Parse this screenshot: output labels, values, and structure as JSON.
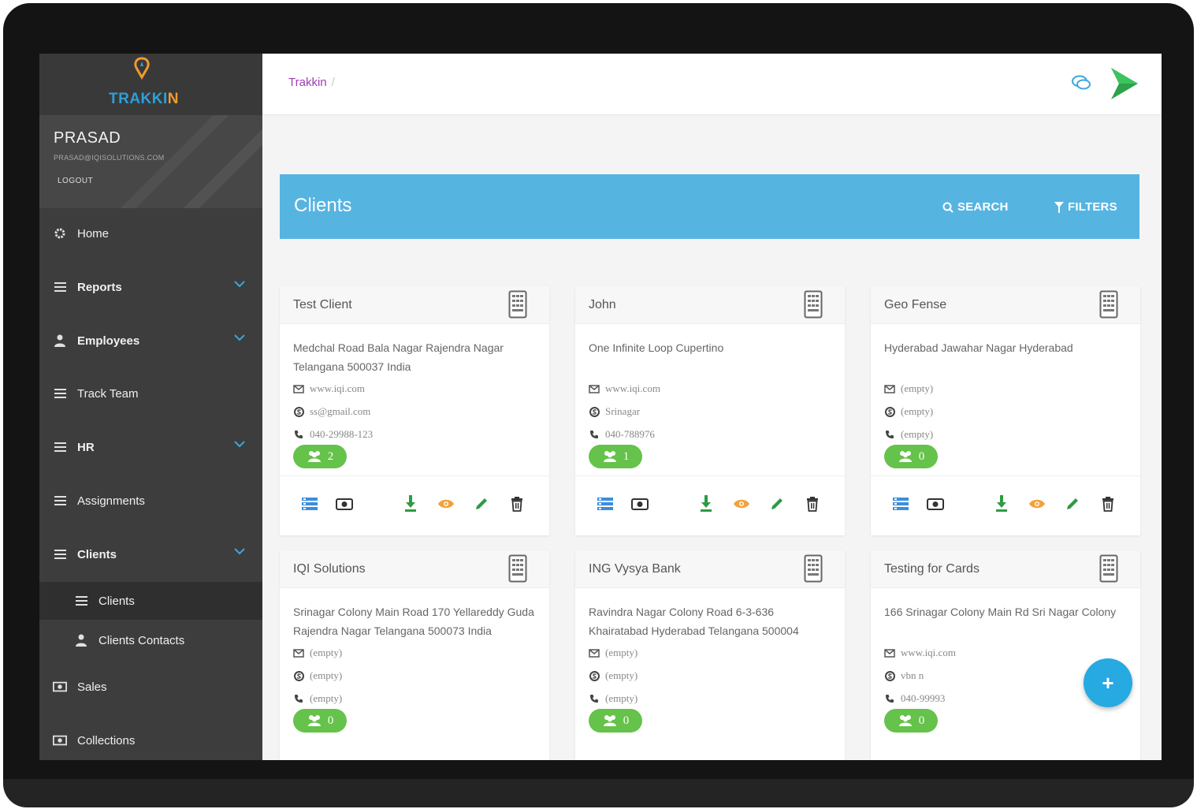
{
  "app": {
    "logo_text_1": "TRAKKI",
    "logo_text_2": "N"
  },
  "user": {
    "name": "PRASAD",
    "email": "PRASAD@IQISOLUTIONS.COM",
    "logout_label": "LOGOUT"
  },
  "sidebar": {
    "items": [
      {
        "label": "Home",
        "icon": "gear-icon"
      },
      {
        "label": "Reports",
        "icon": "list-icon"
      },
      {
        "label": "Employees",
        "icon": "user-icon"
      },
      {
        "label": "Track Team",
        "icon": "list-icon"
      },
      {
        "label": "HR",
        "icon": "list-icon"
      },
      {
        "label": "Assignments",
        "icon": "list-icon"
      },
      {
        "label": "Clients",
        "icon": "list-icon"
      },
      {
        "label": "Clients",
        "icon": "list-icon"
      },
      {
        "label": "Clients Contacts",
        "icon": "user-icon"
      },
      {
        "label": "Sales",
        "icon": "money-icon"
      },
      {
        "label": "Collections",
        "icon": "money-icon"
      }
    ]
  },
  "breadcrumb": {
    "root": "Trakkin",
    "separator": "/"
  },
  "header": {
    "title": "Clients",
    "search_label": "SEARCH",
    "filters_label": "FILTERS"
  },
  "cards": [
    {
      "name": "Test Client",
      "address": "Medchal Road Bala Nagar Rajendra Nagar Telangana 500037 India",
      "website": "www.iqi.com",
      "skype": "ss@gmail.com",
      "phone": "040-29988-123",
      "count": "2"
    },
    {
      "name": "John",
      "address": "One Infinite Loop Cupertino",
      "website": "www.iqi.com",
      "skype": "Srinagar",
      "phone": "040-788976",
      "count": "1"
    },
    {
      "name": "Geo Fense",
      "address": "Hyderabad Jawahar Nagar Hyderabad",
      "website": "(empty)",
      "skype": "(empty)",
      "phone": "(empty)",
      "count": "0"
    },
    {
      "name": "IQI Solutions",
      "address": "Srinagar Colony Main Road 170 Yellareddy Guda Rajendra Nagar Telangana 500073 India",
      "website": "(empty)",
      "skype": "(empty)",
      "phone": "(empty)",
      "count": "0"
    },
    {
      "name": "ING Vysya Bank",
      "address": "Ravindra Nagar Colony Road 6-3-636 Khairatabad Hyderabad Telangana 500004",
      "website": "(empty)",
      "skype": "(empty)",
      "phone": "(empty)",
      "count": "0"
    },
    {
      "name": "Testing for Cards",
      "address": "166 Srinagar Colony Main Rd Sri Nagar Colony",
      "website": "www.iqi.com",
      "skype": "vbn n",
      "phone": "040-99993",
      "count": "0"
    }
  ],
  "fab_label": "+",
  "colors": {
    "accent": "#56b4e1",
    "badge": "#65c24a",
    "sidebar": "#3d3d3d",
    "fab": "#27a9e1",
    "breadcrumb": "#9b3fb0"
  }
}
